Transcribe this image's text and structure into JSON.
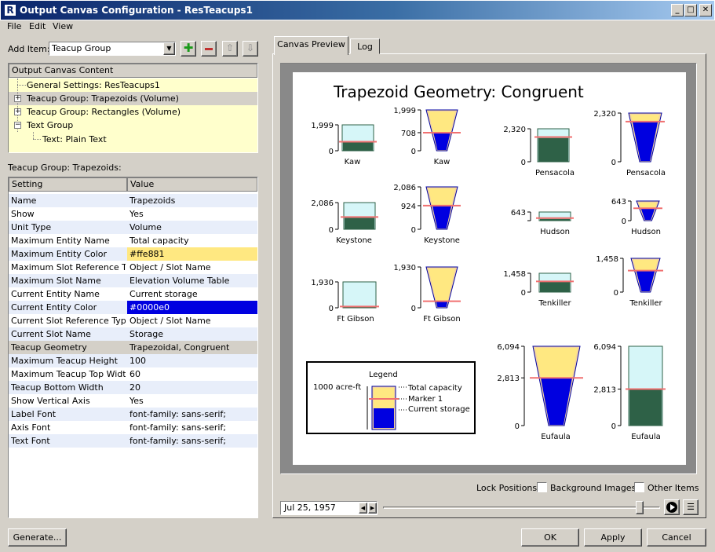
{
  "window": {
    "title": "Output Canvas Configuration - ResTeacups1",
    "app_icon": "app-logo-icon",
    "min_icon": "minimize-icon",
    "max_icon": "maximize-icon",
    "close_icon": "close-icon"
  },
  "menu": [
    "File",
    "Edit",
    "View"
  ],
  "add_item": {
    "label": "Add Item:",
    "selected": "Teacup Group",
    "add_icon": "plus-icon",
    "remove_icon": "minus-icon",
    "up_icon": "arrow-up-icon",
    "down_icon": "arrow-down-icon"
  },
  "content_tree": {
    "header": "Output Canvas Content",
    "items": [
      {
        "label": "General Settings: ResTeacups1",
        "expander": ""
      },
      {
        "label": "Teacup Group: Trapezoids (Volume)",
        "expander": "+"
      },
      {
        "label": "Teacup Group: Rectangles (Volume)",
        "expander": "+"
      },
      {
        "label": "Text Group",
        "expander": "−"
      },
      {
        "label": "Text: Plain Text",
        "expander": ""
      }
    ]
  },
  "props": {
    "section_label": "Teacup Group: Trapezoids:",
    "headers": [
      "Setting",
      "Value"
    ],
    "rows": [
      [
        "Name",
        "Trapezoids"
      ],
      [
        "Show",
        "Yes"
      ],
      [
        "Unit Type",
        "Volume"
      ],
      [
        "Maximum Entity Name",
        "Total capacity"
      ],
      [
        "Maximum Entity Color",
        "#ffe881"
      ],
      [
        "Maximum Slot Reference Type",
        "Object / Slot Name"
      ],
      [
        "Maximum Slot Name",
        "Elevation Volume Table"
      ],
      [
        "Current Entity Name",
        "Current storage"
      ],
      [
        "Current Entity Color",
        "#0000e0"
      ],
      [
        "Current Slot Reference Type",
        "Object / Slot Name"
      ],
      [
        "Current Slot Name",
        "Storage"
      ],
      [
        "Teacup Geometry",
        "Trapezoidal, Congruent"
      ],
      [
        "Maximum Teacup Height",
        "100"
      ],
      [
        "Maximum Teacup Top Width",
        "60"
      ],
      [
        "Teacup Bottom Width",
        "20"
      ],
      [
        "Show Vertical Axis",
        "Yes"
      ],
      [
        "Label Font",
        "font-family: sans-serif;"
      ],
      [
        "Axis Font",
        "font-family: sans-serif;"
      ],
      [
        "Text Font",
        "font-family: sans-serif;"
      ]
    ]
  },
  "tabs": [
    "Canvas Preview",
    "Log"
  ],
  "canvas": {
    "title": "Trapezoid Geometry: Congruent",
    "colors": {
      "max": "#ffe881",
      "current": "#0000e0",
      "rect_max": "#d6f6f8",
      "rect_current": "#2e6147",
      "marker": "#f07070",
      "trap_body": "#f2d3a0"
    },
    "teacups": [
      {
        "name": "Kaw",
        "shape": "rect",
        "max": "1,999",
        "mid": "",
        "zero": "0",
        "fill": 0.32,
        "marker": 0.35
      },
      {
        "name": "Kaw",
        "shape": "trap",
        "max": "1,999",
        "mid": "708",
        "zero": "0",
        "fill": 0.45,
        "marker": 0.47
      },
      {
        "name": "Pensacola",
        "shape": "rect",
        "max": "2,320",
        "mid": "",
        "zero": "0",
        "fill": 0.72,
        "marker": 0.75
      },
      {
        "name": "Pensacola",
        "shape": "trap",
        "max": "2,320",
        "mid": "",
        "zero": "0",
        "fill": 0.85,
        "marker": 0.85
      },
      {
        "name": "Keystone",
        "shape": "rect",
        "max": "2,086",
        "mid": "",
        "zero": "0",
        "fill": 0.43,
        "marker": 0.46
      },
      {
        "name": "Keystone",
        "shape": "trap",
        "max": "2,086",
        "mid": "924",
        "zero": "0",
        "fill": 0.57,
        "marker": 0.58
      },
      {
        "name": "Hudson",
        "shape": "rect",
        "max": "643",
        "mid": "",
        "zero": "",
        "fill": 0.2,
        "marker": 0.3
      },
      {
        "name": "Hudson",
        "shape": "trap",
        "max": "643",
        "mid": "",
        "zero": "0",
        "fill": 0.67,
        "marker": 0.67
      },
      {
        "name": "Ft Gibson",
        "shape": "rect",
        "max": "1,930",
        "mid": "",
        "zero": "0",
        "fill": 0.03,
        "marker": 0.05
      },
      {
        "name": "Ft Gibson",
        "shape": "trap",
        "max": "1,930",
        "mid": "",
        "zero": "0",
        "fill": 0.15,
        "marker": 0.15
      },
      {
        "name": "Tenkiller",
        "shape": "rect",
        "max": "1,458",
        "mid": "",
        "zero": "0",
        "fill": 0.55,
        "marker": 0.57
      },
      {
        "name": "Tenkiller",
        "shape": "trap",
        "max": "1,458",
        "mid": "",
        "zero": "0",
        "fill": 0.66,
        "marker": 0.66
      },
      {
        "name": "Eufaula",
        "shape": "trap",
        "max": "6,094",
        "mid": "2,813",
        "zero": "0",
        "fill": 0.61,
        "marker": 0.61
      },
      {
        "name": "Eufaula",
        "shape": "rect",
        "max": "6,094",
        "mid": "2,813",
        "zero": "0",
        "fill": 0.46,
        "marker": 0.46
      }
    ],
    "legend": {
      "title": "Legend",
      "scale": "1000 acre-ft",
      "items": [
        "Total capacity",
        "Marker 1",
        "Current storage"
      ]
    }
  },
  "lock": {
    "label": "Lock Positions:",
    "bg": "Background Images",
    "other": "Other Items"
  },
  "timeline": {
    "date": "Jul 25, 1957",
    "position": 0.94,
    "play_icon": "play-icon",
    "settings_icon": "list-settings-icon"
  },
  "buttons": {
    "generate": "Generate...",
    "ok": "OK",
    "apply": "Apply",
    "cancel": "Cancel"
  }
}
